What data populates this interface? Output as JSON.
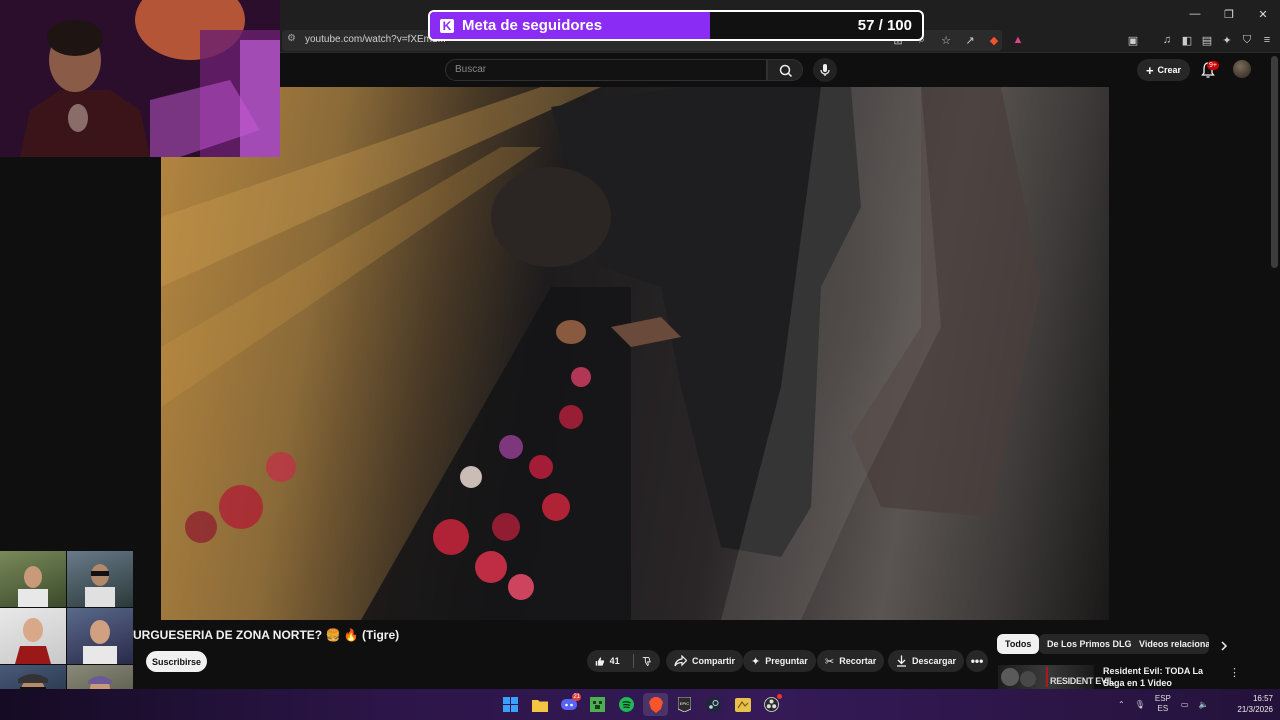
{
  "browser": {
    "url": "youtube.com/watch?v=fXEm1..."
  },
  "goal": {
    "title": "Meta de seguidores",
    "current": 57,
    "target": 100,
    "count_text": "57 / 100",
    "progress": 0.57,
    "fill_color": "#8b2cf5"
  },
  "youtube": {
    "search_placeholder": "Buscar",
    "create_label": "Crear",
    "notif_badge": "9+",
    "video_title": "URGUESERIA DE ZONA NORTE? 🍔 🔥 (Tigre)",
    "subscribe_label": "Suscribirse",
    "like_count": "41",
    "actions": {
      "share": "Compartir",
      "ask": "Preguntar",
      "clip": "Recortar",
      "download": "Descargar"
    },
    "chips": [
      "Todos",
      "De Los Primos DLG",
      "Videos relacionad"
    ],
    "recommended": {
      "title": "Resident Evil: TODA La Saga en 1 Video",
      "thumb_text": "RESIDENT EVIL"
    }
  },
  "taskbar": {
    "discord_badge": "21",
    "lang_top": "ESP",
    "lang_bottom": "ES",
    "time": "16:57",
    "date": "21/3/2026"
  },
  "icons": {
    "window": [
      "minimize-icon",
      "maximize-icon",
      "close-icon"
    ],
    "taskbar": [
      "windows-start-icon",
      "file-explorer-icon",
      "discord-icon",
      "minecraft-icon",
      "spotify-icon",
      "brave-icon",
      "epic-games-icon",
      "steam-icon",
      "folder-app-icon",
      "obs-icon"
    ]
  }
}
